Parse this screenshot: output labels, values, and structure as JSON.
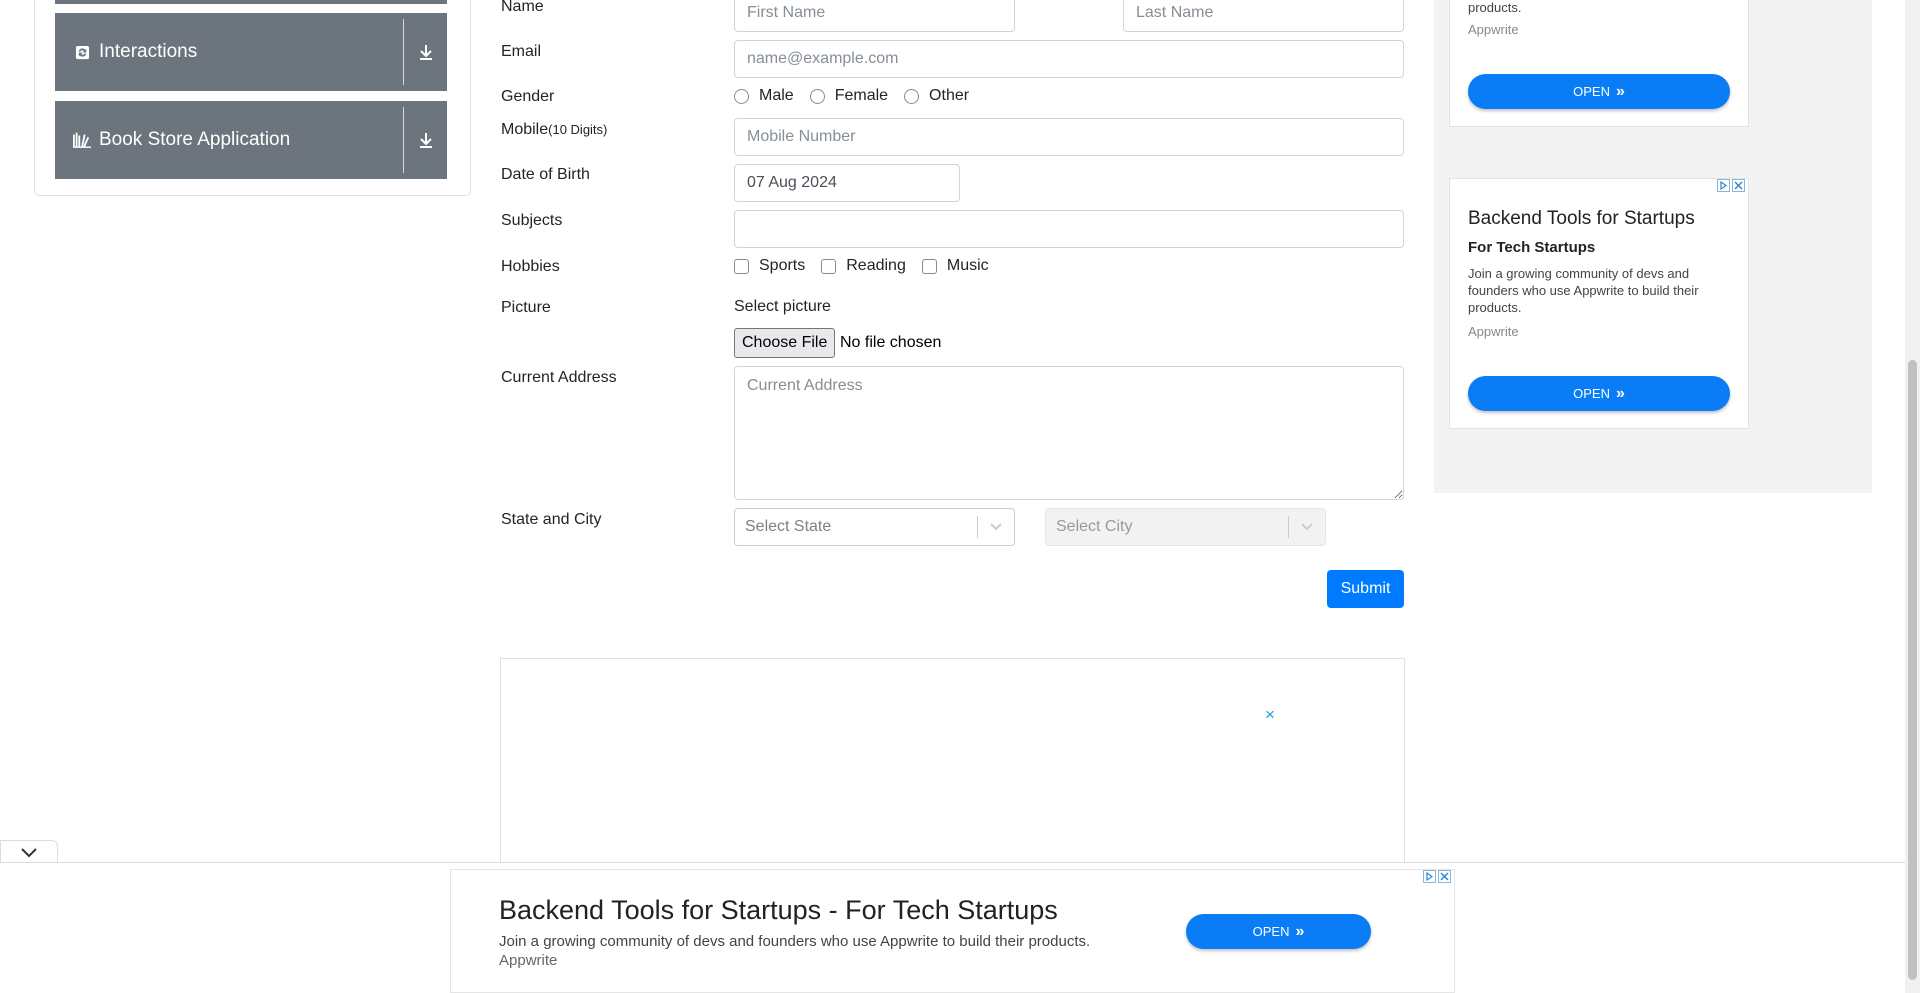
{
  "sidebar": {
    "groups": [
      {
        "label": "Interactions",
        "icon": "interactions-icon"
      },
      {
        "label": "Book Store Application",
        "icon": "book-icon"
      }
    ]
  },
  "form": {
    "name_label": "Name",
    "first_name_placeholder": "First Name",
    "last_name_placeholder": "Last Name",
    "email_label": "Email",
    "email_placeholder": "name@example.com",
    "gender_label": "Gender",
    "gender_options": [
      "Male",
      "Female",
      "Other"
    ],
    "mobile_label": "Mobile",
    "mobile_hint": "(10 Digits)",
    "mobile_placeholder": "Mobile Number",
    "dob_label": "Date of Birth",
    "dob_value": "07 Aug 2024",
    "subjects_label": "Subjects",
    "hobbies_label": "Hobbies",
    "hobbies_options": [
      "Sports",
      "Reading",
      "Music"
    ],
    "picture_label": "Picture",
    "select_picture_text": "Select picture",
    "choose_file_label": "Choose File",
    "no_file_text": "No file chosen",
    "address_label": "Current Address",
    "address_placeholder": "Current Address",
    "state_city_label": "State and City",
    "state_placeholder": "Select State",
    "city_placeholder": "Select City",
    "submit_label": "Submit"
  },
  "ads": {
    "right_top": {
      "body_tail": "products.",
      "brand": "Appwrite",
      "open_label": "OPEN"
    },
    "right_card": {
      "title": "Backend Tools for Startups",
      "subtitle": "For Tech Startups",
      "body": "Join a growing community of devs and founders who use Appwrite to build their products.",
      "brand": "Appwrite",
      "open_label": "OPEN"
    },
    "bottom": {
      "title": "Backend Tools for Startups - For Tech Startups",
      "body": "Join a growing community of devs and founders who use Appwrite to build their products.",
      "brand": "Appwrite",
      "open_label": "OPEN"
    },
    "close_glyph": "×"
  },
  "colors": {
    "primary": "#007bff",
    "sidebar_group": "#6c757d",
    "ad_button": "#0a7cf5"
  }
}
